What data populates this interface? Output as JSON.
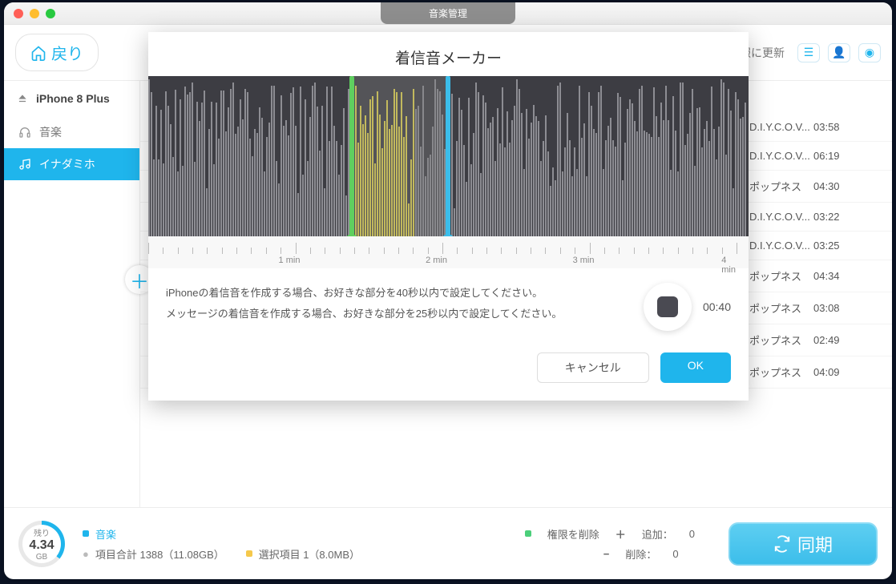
{
  "window_title": "音楽管理",
  "back": "戻り",
  "refresh": "最新の情報に更新",
  "device": "iPhone 8 Plus",
  "sidebar": {
    "music": "音楽",
    "ringtones": "イナダミホ"
  },
  "modal": {
    "title": "着信音メーカー",
    "line1": "iPhoneの着信音を作成する場合、お好きな部分を40秒以内で設定してください。",
    "line2": "メッセージの着信音を作成する場合、お好きな部分を25秒以内で設定してください。",
    "time": "00:40",
    "cancel": "キャンセル",
    "ok": "OK",
    "ruler": {
      "m1": "1 min",
      "m2": "2 min",
      "m3": "3 min",
      "m4": "4 min"
    }
  },
  "tracks": [
    {
      "artist": "D.I.Y.C.O.V...",
      "duration": "03:58"
    },
    {
      "artist": "D.I.Y.C.O.V...",
      "duration": "06:19"
    },
    {
      "artist": "ポップネス",
      "duration": "04:30"
    },
    {
      "artist": "D.I.Y.C.O.V...",
      "duration": "03:22"
    },
    {
      "artist": "D.I.Y.C.O.V...",
      "duration": "03:25"
    },
    {
      "artist": "ポップネス",
      "duration": "04:34"
    },
    {
      "artist": "ポップネス",
      "duration": "03:08"
    },
    {
      "artist": "ポップネス",
      "duration": "02:49"
    },
    {
      "artist": "ポップネス",
      "duration": "04:09"
    }
  ],
  "footer": {
    "gauge_label": "残り",
    "gauge_value": "4.34",
    "gauge_unit": "GB",
    "music": "音楽",
    "total": "項目合計 1388（11.08GB）",
    "selected": "選択項目 1（8.0MB）",
    "perm_delete": "権限を削除",
    "add_label": "追加：",
    "del_label": "削除：",
    "add_count": "0",
    "del_count": "0",
    "sync": "同期"
  }
}
